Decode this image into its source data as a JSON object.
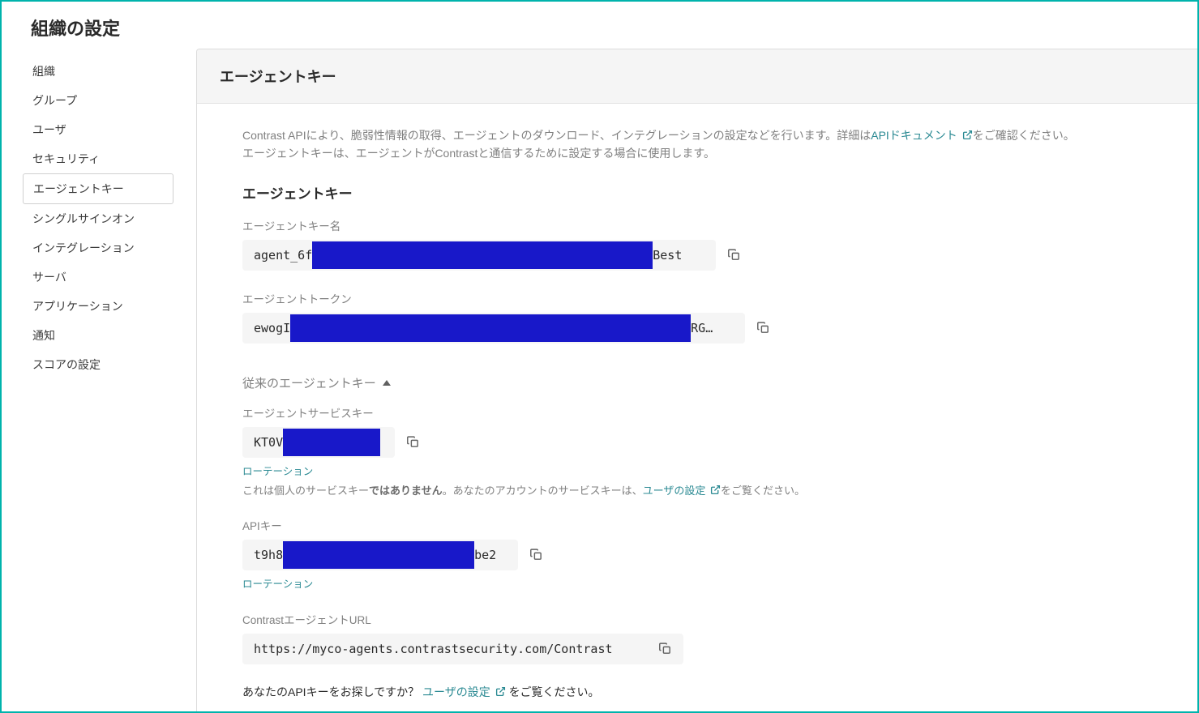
{
  "page": {
    "title": "組織の設定"
  },
  "sidebar": {
    "items": [
      {
        "label": "組織"
      },
      {
        "label": "グループ"
      },
      {
        "label": "ユーザ"
      },
      {
        "label": "セキュリティ"
      },
      {
        "label": "エージェントキー"
      },
      {
        "label": "シングルサインオン"
      },
      {
        "label": "インテグレーション"
      },
      {
        "label": "サーバ"
      },
      {
        "label": "アプリケーション"
      },
      {
        "label": "通知"
      },
      {
        "label": "スコアの設定"
      }
    ],
    "activeIndex": 4
  },
  "main": {
    "header": "エージェントキー"
  },
  "intro": {
    "line1_a": "Contrast APIにより、脆弱性情報の取得、エージェントのダウンロード、インテグレーションの設定などを行います。詳細は",
    "api_link": "APIドキュメント",
    "line1_b": "をご確認ください。",
    "line2": "エージェントキーは、エージェントがContrastと通信するために設定する場合に使用します。"
  },
  "agentKeys": {
    "section_title": "エージェントキー",
    "name": {
      "label": "エージェントキー名",
      "prefix": "agent_6f",
      "suffix": "Best"
    },
    "token": {
      "label": "エージェントトークン",
      "prefix": "ewogI",
      "suffix": "RG…"
    }
  },
  "legacy": {
    "header": "従来のエージェントキー",
    "service_key": {
      "label": "エージェントサービスキー",
      "prefix": "KT0V",
      "rotate": "ローテーション",
      "help_a": "これは個人のサービスキー",
      "help_b": "ではありません",
      "help_c": "。あなたのアカウントのサービスキーは、",
      "help_link": "ユーザの設定",
      "help_d": "をご覧ください。"
    },
    "api_key": {
      "label": "APIキー",
      "prefix": "t9h8",
      "suffix": "be2",
      "rotate": "ローテーション"
    },
    "agent_url": {
      "label": "ContrastエージェントURL",
      "value": "https://myco-agents.contrastsecurity.com/Contrast"
    }
  },
  "footer": {
    "text_a": "あなたのAPIキーをお探しですか？",
    "link": "ユーザの設定",
    "text_b": "をご覧ください。"
  }
}
